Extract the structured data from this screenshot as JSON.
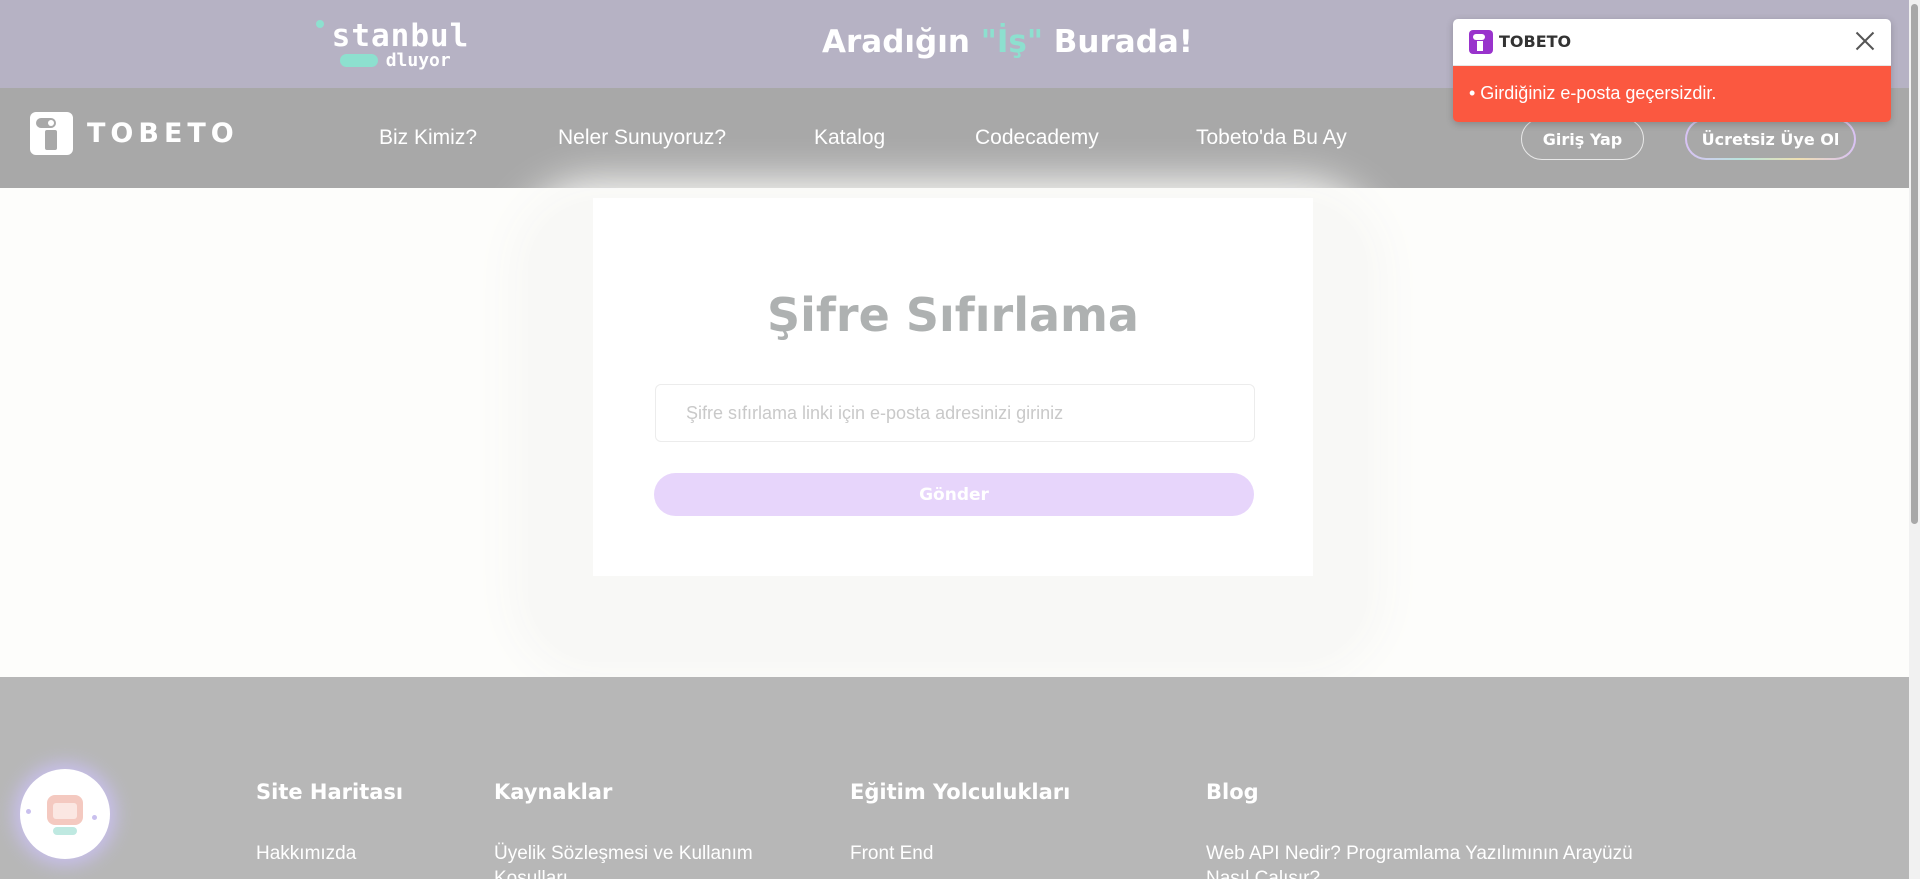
{
  "banner": {
    "logo_top": "stanbul",
    "logo_bottom": "dluyor",
    "slogan_before": "Aradığın ",
    "slogan_highlight": "\"İş\"",
    "slogan_after": " Burada!"
  },
  "nav": {
    "brand": "TOBETO",
    "links": [
      "Biz Kimiz?",
      "Neler Sunuyoruz?",
      "Katalog",
      "Codecademy",
      "Tobeto'da Bu Ay"
    ],
    "login_label": "Giriş Yap",
    "signup_label": "Ücretsiz Üye Ol"
  },
  "reset": {
    "title": "Şifre Sıfırlama",
    "email_placeholder": "Şifre sıfırlama linki için e-posta adresinizi giriniz",
    "send_label": "Gönder"
  },
  "footer": {
    "columns": [
      {
        "heading": "Site Haritası",
        "links": [
          "Hakkımızda"
        ],
        "continued": ""
      },
      {
        "heading": "Kaynaklar",
        "links": [
          "Üyelik Sözleşmesi ve Kullanım"
        ],
        "continued": "Koşulları"
      },
      {
        "heading": "Eğitim Yolculukları",
        "links": [
          "Front End"
        ],
        "continued": ""
      },
      {
        "heading": "Blog",
        "links": [
          "Web API Nedir? Programlama Yazılımının Arayüzü"
        ],
        "continued": "Nasıl Çalışır?"
      }
    ]
  },
  "toast": {
    "title": "TOBETO",
    "message": "• Girdiğiniz e-posta geçersizdir."
  },
  "colors": {
    "banner_bg": "#b6b2c4",
    "nav_bg": "#a8a8a8",
    "accent_mint": "#8de0cf",
    "send_button": "#e7d5fb",
    "toast_error": "#fb5840",
    "brand_purple": "#9933cc"
  },
  "icons": [
    "istanbul-kodluyor-logo",
    "tobeto-logo-icon",
    "chatbot-icon",
    "tobeto-toast-icon",
    "close-icon"
  ]
}
